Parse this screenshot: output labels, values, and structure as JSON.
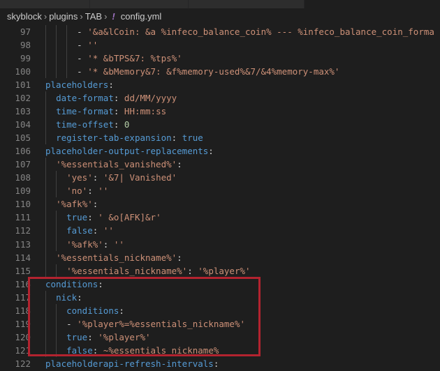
{
  "breadcrumb": [
    "skyblock",
    "plugins",
    "TAB",
    "config.yml"
  ],
  "file_icon": "yaml-exclamation-icon",
  "colors": {
    "key": "#569cd6",
    "string": "#ce9178",
    "number": "#b5cea8",
    "highlight_box": "#b3232f"
  },
  "lines": [
    {
      "n": "97",
      "indent": 6,
      "t": [
        [
          "p",
          "- "
        ],
        [
          "s",
          "'&a&lCoin: &a %infeco_balance_coin% --- %infeco_balance_coin_forma"
        ]
      ]
    },
    {
      "n": "98",
      "indent": 6,
      "t": [
        [
          "p",
          "- "
        ],
        [
          "s",
          "''"
        ]
      ]
    },
    {
      "n": "99",
      "indent": 6,
      "t": [
        [
          "p",
          "- "
        ],
        [
          "s",
          "'* &bTPS&7: %tps%'"
        ]
      ]
    },
    {
      "n": "100",
      "indent": 6,
      "t": [
        [
          "p",
          "- "
        ],
        [
          "s",
          "'* &bMemory&7: &f%memory-used%&7/&4%memory-max%'"
        ]
      ]
    },
    {
      "n": "101",
      "indent": 0,
      "t": [
        [
          "k",
          "placeholders"
        ],
        [
          "p",
          ":"
        ]
      ]
    },
    {
      "n": "102",
      "indent": 2,
      "t": [
        [
          "k",
          "date-format"
        ],
        [
          "p",
          ": "
        ],
        [
          "s",
          "dd/MM/yyyy"
        ]
      ]
    },
    {
      "n": "103",
      "indent": 2,
      "t": [
        [
          "k",
          "time-format"
        ],
        [
          "p",
          ": "
        ],
        [
          "s",
          "HH:mm:ss"
        ]
      ]
    },
    {
      "n": "104",
      "indent": 2,
      "t": [
        [
          "k",
          "time-offset"
        ],
        [
          "p",
          ": "
        ],
        [
          "n",
          "0"
        ]
      ]
    },
    {
      "n": "105",
      "indent": 2,
      "t": [
        [
          "k",
          "register-tab-expansion"
        ],
        [
          "p",
          ": "
        ],
        [
          "b",
          "true"
        ]
      ]
    },
    {
      "n": "106",
      "indent": 0,
      "t": [
        [
          "k",
          "placeholder-output-replacements"
        ],
        [
          "p",
          ":"
        ]
      ]
    },
    {
      "n": "107",
      "indent": 2,
      "t": [
        [
          "s",
          "'%essentials_vanished%'"
        ],
        [
          "p",
          ":"
        ]
      ]
    },
    {
      "n": "108",
      "indent": 4,
      "t": [
        [
          "s",
          "'yes'"
        ],
        [
          "p",
          ": "
        ],
        [
          "s",
          "'&7| Vanished'"
        ]
      ]
    },
    {
      "n": "109",
      "indent": 4,
      "t": [
        [
          "s",
          "'no'"
        ],
        [
          "p",
          ": "
        ],
        [
          "s",
          "''"
        ]
      ]
    },
    {
      "n": "110",
      "indent": 2,
      "t": [
        [
          "s",
          "'%afk%'"
        ],
        [
          "p",
          ":"
        ]
      ]
    },
    {
      "n": "111",
      "indent": 4,
      "t": [
        [
          "k",
          "true"
        ],
        [
          "p",
          ": "
        ],
        [
          "s",
          "' &o[AFK]&r'"
        ]
      ]
    },
    {
      "n": "112",
      "indent": 4,
      "t": [
        [
          "k",
          "false"
        ],
        [
          "p",
          ": "
        ],
        [
          "s",
          "''"
        ]
      ]
    },
    {
      "n": "113",
      "indent": 4,
      "t": [
        [
          "s",
          "'%afk%'"
        ],
        [
          "p",
          ": "
        ],
        [
          "s",
          "''"
        ]
      ]
    },
    {
      "n": "114",
      "indent": 2,
      "t": [
        [
          "s",
          "'%essentials_nickname%'"
        ],
        [
          "p",
          ":"
        ]
      ]
    },
    {
      "n": "115",
      "indent": 4,
      "t": [
        [
          "s",
          "'%essentials_nickname%'"
        ],
        [
          "p",
          ": "
        ],
        [
          "s",
          "'%player%'"
        ]
      ]
    },
    {
      "n": "116",
      "indent": 0,
      "t": [
        [
          "k",
          "conditions"
        ],
        [
          "p",
          ":"
        ]
      ]
    },
    {
      "n": "117",
      "indent": 2,
      "t": [
        [
          "k",
          "nick"
        ],
        [
          "p",
          ":"
        ]
      ]
    },
    {
      "n": "118",
      "indent": 4,
      "t": [
        [
          "k",
          "conditions"
        ],
        [
          "p",
          ":"
        ]
      ]
    },
    {
      "n": "119",
      "indent": 4,
      "t": [
        [
          "p",
          "- "
        ],
        [
          "s",
          "'%player%=%essentials_nickname%'"
        ]
      ]
    },
    {
      "n": "120",
      "indent": 4,
      "t": [
        [
          "k",
          "true"
        ],
        [
          "p",
          ": "
        ],
        [
          "s",
          "'%player%'"
        ]
      ]
    },
    {
      "n": "121",
      "indent": 4,
      "t": [
        [
          "k",
          "false"
        ],
        [
          "p",
          ": "
        ],
        [
          "s",
          "~%essentials_nickname%"
        ]
      ]
    },
    {
      "n": "122",
      "indent": 0,
      "t": [
        [
          "k",
          "placeholderapi-refresh-intervals"
        ],
        [
          "p",
          ":"
        ]
      ]
    }
  ]
}
